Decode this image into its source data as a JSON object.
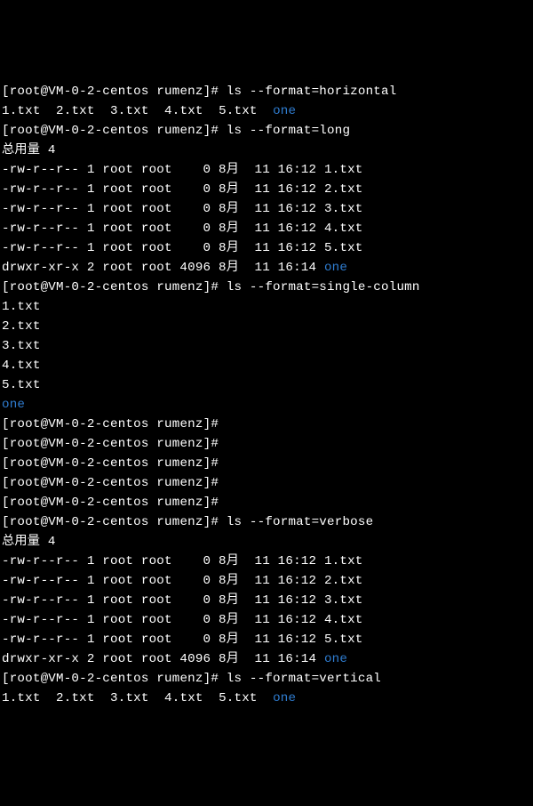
{
  "prompt": {
    "open": "[",
    "userhost": "root@VM-0-2-centos",
    "space": " ",
    "cwd": "rumenz",
    "close": "]",
    "hash": "#"
  },
  "commands": {
    "horizontal": "ls --format=horizontal",
    "long": "ls --format=long",
    "single": "ls --format=single-column",
    "verbose": "ls --format=verbose",
    "vertical": "ls --format=vertical",
    "empty": ""
  },
  "horizontal_listing": {
    "f1": "1.txt",
    "f2": "2.txt",
    "f3": "3.txt",
    "f4": "4.txt",
    "f5": "5.txt",
    "d1": "one",
    "sep": "  "
  },
  "total_line": "总用量 4",
  "long_rows": [
    {
      "perm": "-rw-r--r--",
      "lnk": "1",
      "own": "root",
      "grp": "root",
      "size": "   0",
      "mon": "8月",
      "day": "11",
      "time": "16:12",
      "name": "1.txt",
      "isdir": false
    },
    {
      "perm": "-rw-r--r--",
      "lnk": "1",
      "own": "root",
      "grp": "root",
      "size": "   0",
      "mon": "8月",
      "day": "11",
      "time": "16:12",
      "name": "2.txt",
      "isdir": false
    },
    {
      "perm": "-rw-r--r--",
      "lnk": "1",
      "own": "root",
      "grp": "root",
      "size": "   0",
      "mon": "8月",
      "day": "11",
      "time": "16:12",
      "name": "3.txt",
      "isdir": false
    },
    {
      "perm": "-rw-r--r--",
      "lnk": "1",
      "own": "root",
      "grp": "root",
      "size": "   0",
      "mon": "8月",
      "day": "11",
      "time": "16:12",
      "name": "4.txt",
      "isdir": false
    },
    {
      "perm": "-rw-r--r--",
      "lnk": "1",
      "own": "root",
      "grp": "root",
      "size": "   0",
      "mon": "8月",
      "day": "11",
      "time": "16:12",
      "name": "5.txt",
      "isdir": false
    },
    {
      "perm": "drwxr-xr-x",
      "lnk": "2",
      "own": "root",
      "grp": "root",
      "size": "4096",
      "mon": "8月",
      "day": "11",
      "time": "16:14",
      "name": "one",
      "isdir": true
    }
  ],
  "single_column": [
    {
      "name": "1.txt",
      "isdir": false
    },
    {
      "name": "2.txt",
      "isdir": false
    },
    {
      "name": "3.txt",
      "isdir": false
    },
    {
      "name": "4.txt",
      "isdir": false
    },
    {
      "name": "5.txt",
      "isdir": false
    },
    {
      "name": "one",
      "isdir": true
    }
  ]
}
